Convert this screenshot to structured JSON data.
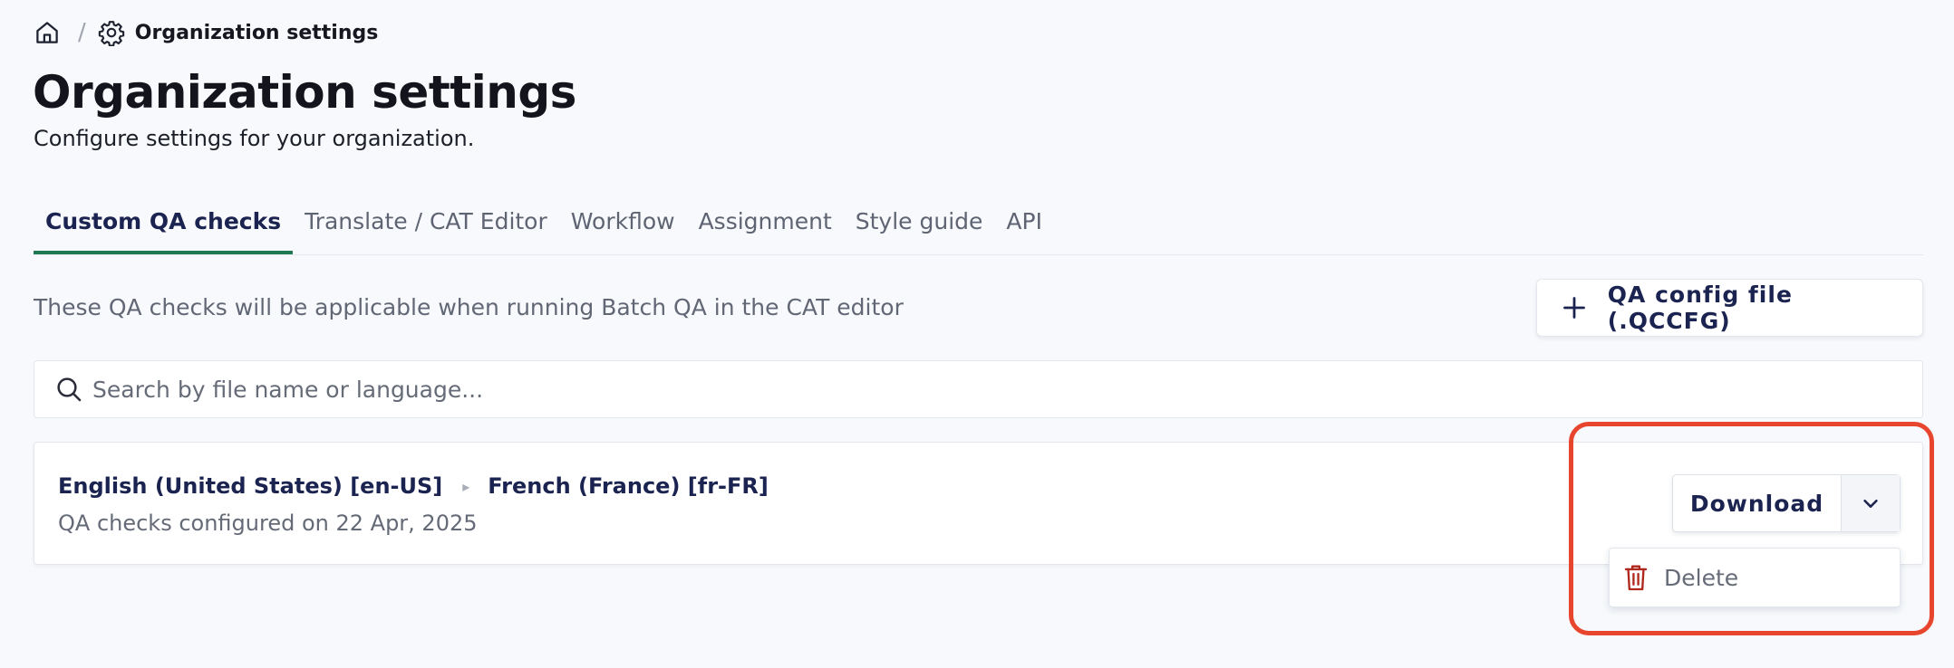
{
  "breadcrumb": {
    "home_icon": "home-icon",
    "separator": "/",
    "settings_icon": "gear-icon",
    "current": "Organization settings"
  },
  "header": {
    "title": "Organization settings",
    "subtitle": "Configure settings for your organization."
  },
  "tabs": [
    {
      "label": "Custom QA checks",
      "active": true
    },
    {
      "label": "Translate / CAT Editor",
      "active": false
    },
    {
      "label": "Workflow",
      "active": false
    },
    {
      "label": "Assignment",
      "active": false
    },
    {
      "label": "Style guide",
      "active": false
    },
    {
      "label": "API",
      "active": false
    }
  ],
  "qa": {
    "info": "These QA checks will be applicable when running Batch QA in the CAT editor",
    "add_button_label": "QA config file (.QCCFG)",
    "add_icon": "plus-icon"
  },
  "search": {
    "placeholder": "Search by file name or language...",
    "value": "",
    "icon": "search-icon"
  },
  "items": [
    {
      "source_lang": "English (United States) [en-US]",
      "target_lang": "French (France) [fr-FR]",
      "arrow": "▸",
      "configured": "QA checks configured on 22 Apr, 2025",
      "download_label": "Download",
      "menu": [
        {
          "label": "Delete",
          "icon": "trash-icon"
        }
      ]
    }
  ],
  "colors": {
    "accent_tab": "#1f7a4f",
    "primary_text": "#1b2350",
    "delete_icon": "#b0281d",
    "highlight": "#e8452f",
    "background": "#f7f9fc"
  }
}
